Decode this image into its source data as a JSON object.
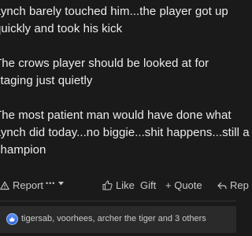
{
  "post": {
    "paragraphs": [
      [
        "Lynch barely touched him...the player got up",
        "quickly and took his kick"
      ],
      [
        "The crows player should be looked at for",
        "staging just quietly"
      ],
      [
        "The most patient man would have done what",
        "Lynch did today...no biggie...shit happens...still a",
        "champion"
      ]
    ]
  },
  "actions": {
    "report": "Report",
    "more": "•••",
    "like": "Like",
    "reply_quote": "Gift",
    "quote": "+ Quote",
    "reply": "Rep"
  },
  "reactions": {
    "icon": "like-icon",
    "text": "tigersab, voorhees, archer the tiger and 3 others"
  }
}
